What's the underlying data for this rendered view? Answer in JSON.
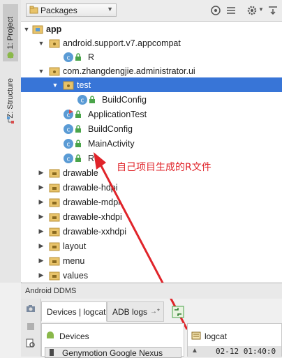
{
  "left_strip": {
    "project_tab": "1: Project",
    "structure_tab": "Z: Structure"
  },
  "toolbar": {
    "view_selector": "Packages",
    "icons": [
      "target-icon",
      "collapse-icon",
      "gear-icon",
      "hide-icon"
    ]
  },
  "tree": {
    "rows": [
      {
        "label": "app",
        "bold": true
      },
      {
        "label": "android.support.v7.appcompat"
      },
      {
        "label": "R"
      },
      {
        "label": "com.zhangdengjie.administrator.ui"
      },
      {
        "label": "test"
      },
      {
        "label": "BuildConfig"
      },
      {
        "label": "ApplicationTest"
      },
      {
        "label": "BuildConfig"
      },
      {
        "label": "MainActivity"
      },
      {
        "label": "R"
      },
      {
        "label": "drawable"
      },
      {
        "label": "drawable-hdpi"
      },
      {
        "label": "drawable-mdpi"
      },
      {
        "label": "drawable-xhdpi"
      },
      {
        "label": "drawable-xxhdpi"
      },
      {
        "label": "layout"
      },
      {
        "label": "menu"
      },
      {
        "label": "values"
      }
    ]
  },
  "annotation": "自己项目生成的R文件",
  "ddms": {
    "title": "Android DDMS",
    "tabs": [
      "Devices | logcat",
      "ADB logs"
    ],
    "devices_header": "Devices",
    "device_selected": "Genymotion Google Nexus",
    "logcat_header": "logcat",
    "logcat_line": "02-12 01:40:0"
  },
  "colors": {
    "selection": "#3875d7",
    "annotation": "#e0242a",
    "folder": "#e8c36a",
    "class_circle": "#5a9bd5"
  }
}
